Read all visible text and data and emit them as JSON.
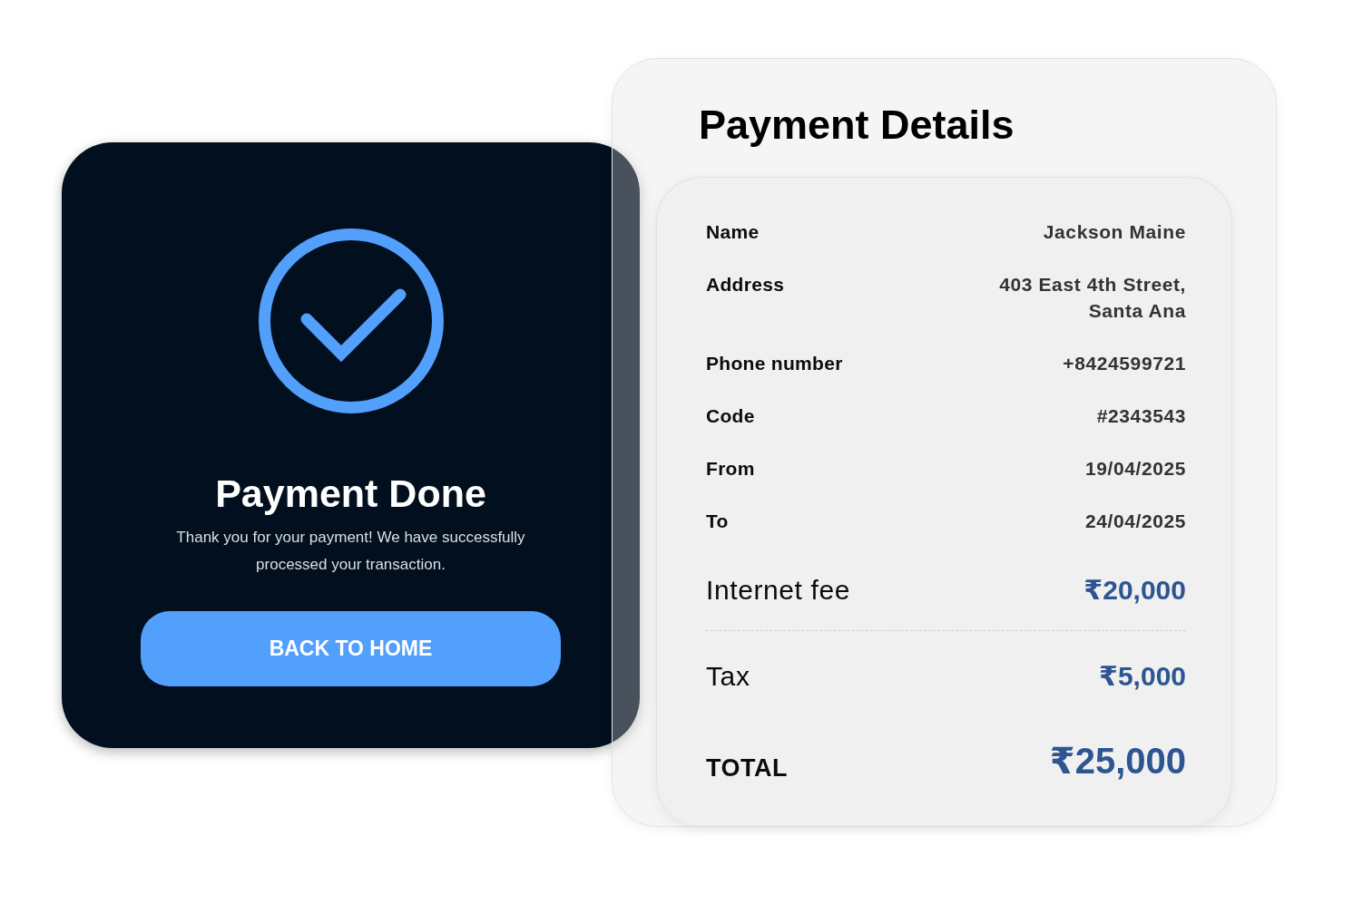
{
  "success_card": {
    "title": "Payment Done",
    "message": "Thank you for your payment! We have successfully processed your transaction.",
    "button": "BACK TO HOME"
  },
  "payment_details": {
    "title": "Payment Details",
    "rows": [
      {
        "label": "Name",
        "value": "Jackson Maine"
      },
      {
        "label": "Address",
        "value": "403 East 4th Street, Santa Ana"
      },
      {
        "label": "Phone number",
        "value": "+8424599721"
      },
      {
        "label": "Code",
        "value": "#2343543"
      },
      {
        "label": "From",
        "value": "19/04/2025"
      },
      {
        "label": "To",
        "value": "24/04/2025"
      }
    ],
    "charges": [
      {
        "label": "Internet fee",
        "value": "₹20,000"
      },
      {
        "label": "Tax",
        "value": "₹5,000"
      }
    ],
    "total": {
      "label": "TOTAL",
      "value": "₹25,000"
    }
  }
}
